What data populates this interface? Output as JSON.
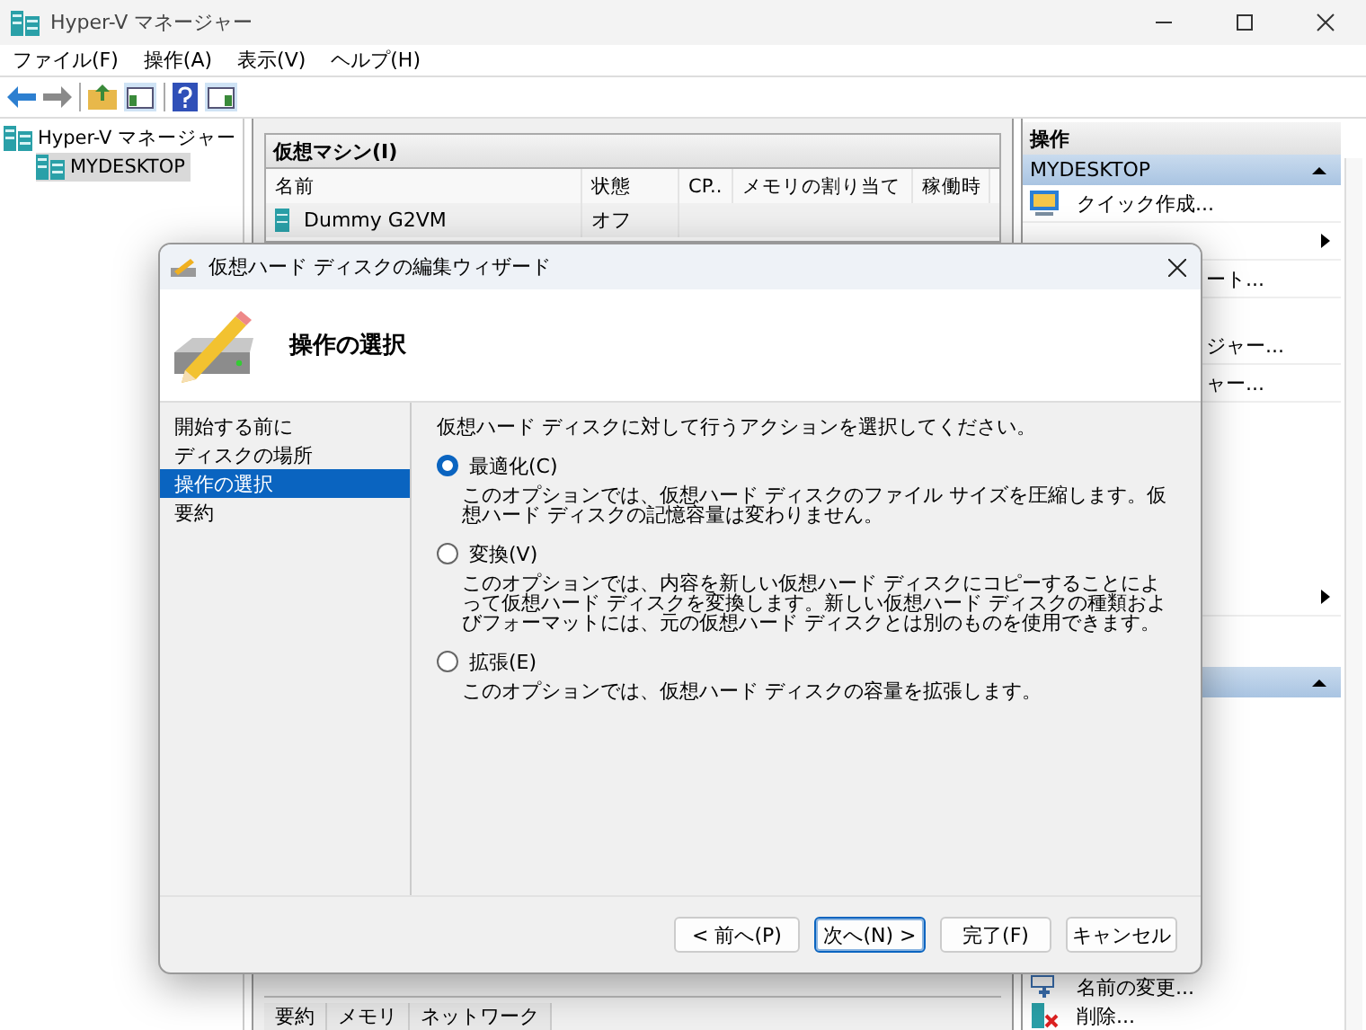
{
  "window": {
    "title": "Hyper-V マネージャー"
  },
  "menu": [
    "ファイル(F)",
    "操作(A)",
    "表示(V)",
    "ヘルプ(H)"
  ],
  "tree": [
    {
      "label": "Hyper-V マネージャー",
      "selected": false,
      "children": [
        {
          "label": "MYDESKTOP",
          "selected": true
        }
      ]
    }
  ],
  "vm_panel": {
    "title": "仮想マシン(I)",
    "columns": [
      "名前",
      "状態",
      "CP..",
      "メモリの割り当て",
      "稼働時"
    ],
    "rows": [
      {
        "name": "Dummy G2VM",
        "state": "オフ"
      }
    ]
  },
  "details_tabs": [
    "要約",
    "メモリ",
    "ネットワーク"
  ],
  "actions": {
    "title": "操作",
    "header": "MYDESKTOP",
    "items": [
      {
        "kind": "item",
        "label": "クイック作成..."
      },
      {
        "kind": "submenu"
      },
      {
        "kind": "partial",
        "label": "ート..."
      },
      {
        "kind": "separator"
      },
      {
        "kind": "partial",
        "label": "ジャー..."
      },
      {
        "kind": "partial",
        "label": "ャー..."
      },
      {
        "kind": "submenu"
      }
    ],
    "bottom_items": [
      {
        "kind": "rename",
        "label": "名前の変更..."
      },
      {
        "kind": "delete",
        "label": "削除..."
      }
    ]
  },
  "dialog": {
    "title": "仮想ハード ディスクの編集ウィザード",
    "heading": "操作の選択",
    "steps": [
      {
        "label": "開始する前に",
        "selected": false
      },
      {
        "label": "ディスクの場所",
        "selected": false
      },
      {
        "label": "操作の選択",
        "selected": true
      },
      {
        "label": "要約",
        "selected": false
      }
    ],
    "prompt": "仮想ハード ディスクに対して行うアクションを選択してください。",
    "options": [
      {
        "label": "最適化(C)",
        "selected": true,
        "description": "このオプションでは、仮想ハード ディスクのファイル サイズを圧縮します。仮想ハード ディスクの記憶容量は変わりません。"
      },
      {
        "label": "変換(V)",
        "selected": false,
        "description": "このオプションでは、内容を新しい仮想ハード ディスクにコピーすることによって仮想ハード ディスクを変換します。新しい仮想ハード ディスクの種類およびフォーマットには、元の仮想ハード ディスクとは別のものを使用できます。"
      },
      {
        "label": "拡張(E)",
        "selected": false,
        "description": "このオプションでは、仮想ハード ディスクの容量を拡張します。"
      }
    ],
    "buttons": [
      {
        "label": "< 前へ(P)",
        "default": false
      },
      {
        "label": "次へ(N) >",
        "default": true
      },
      {
        "label": "完了(F)",
        "default": false
      },
      {
        "label": "キャンセル",
        "default": false
      }
    ]
  }
}
